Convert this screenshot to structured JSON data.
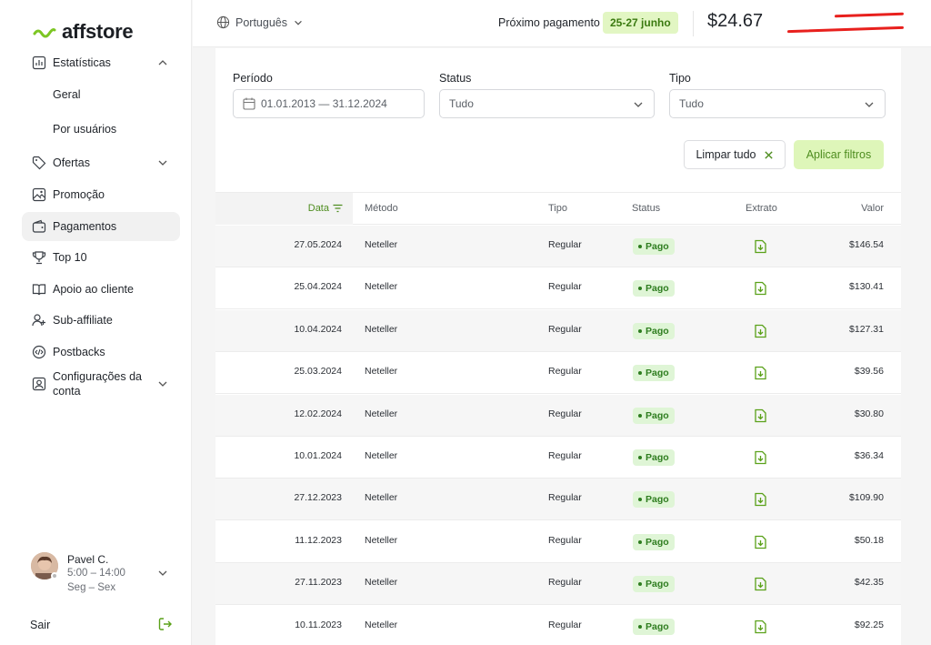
{
  "brand": {
    "name": "affstore",
    "accent": "#7cc623"
  },
  "sidebar": {
    "items": [
      {
        "label": "Estatísticas",
        "icon": "bar-chart-icon"
      },
      {
        "label": "Ofertas",
        "icon": "tag-icon"
      },
      {
        "label": "Promoção",
        "icon": "image-icon"
      },
      {
        "label": "Pagamentos",
        "icon": "wallet-icon"
      },
      {
        "label": "Top 10",
        "icon": "trophy-icon"
      },
      {
        "label": "Apoio ao cliente",
        "icon": "book-icon"
      },
      {
        "label": "Sub-affiliate",
        "icon": "user-plus-icon"
      },
      {
        "label": "Postbacks",
        "icon": "code-icon"
      },
      {
        "label": "Configurações da conta",
        "icon": "account-icon"
      }
    ],
    "sub_items": [
      "Geral",
      "Por usuários"
    ],
    "user": {
      "name": "Pavel C.",
      "hours": "5:00 – 14:00",
      "days": "Seg – Sex"
    },
    "logout_label": "Sair"
  },
  "topbar": {
    "language": "Português",
    "next_payment_label": "Próximo pagamento",
    "next_payment_dates": "25-27 junho",
    "balance": "$24.67"
  },
  "filters": {
    "period_label": "Período",
    "period_value": "01.01.2013 — 31.12.2024",
    "status_label": "Status",
    "status_value": "Tudo",
    "type_label": "Tipo",
    "type_value": "Tudo",
    "clear_label": "Limpar tudo",
    "apply_label": "Aplicar filtros"
  },
  "table": {
    "columns": [
      "Data",
      "Método",
      "Tipo",
      "Status",
      "Extrato",
      "Valor"
    ],
    "rows": [
      {
        "date": "27.05.2024",
        "method": "Neteller",
        "type": "Regular",
        "status": "Pago",
        "value": "$146.54"
      },
      {
        "date": "25.04.2024",
        "method": "Neteller",
        "type": "Regular",
        "status": "Pago",
        "value": "$130.41"
      },
      {
        "date": "10.04.2024",
        "method": "Neteller",
        "type": "Regular",
        "status": "Pago",
        "value": "$127.31"
      },
      {
        "date": "25.03.2024",
        "method": "Neteller",
        "type": "Regular",
        "status": "Pago",
        "value": "$39.56"
      },
      {
        "date": "12.02.2024",
        "method": "Neteller",
        "type": "Regular",
        "status": "Pago",
        "value": "$30.80"
      },
      {
        "date": "10.01.2024",
        "method": "Neteller",
        "type": "Regular",
        "status": "Pago",
        "value": "$36.34"
      },
      {
        "date": "27.12.2023",
        "method": "Neteller",
        "type": "Regular",
        "status": "Pago",
        "value": "$109.90"
      },
      {
        "date": "11.12.2023",
        "method": "Neteller",
        "type": "Regular",
        "status": "Pago",
        "value": "$50.18"
      },
      {
        "date": "27.11.2023",
        "method": "Neteller",
        "type": "Regular",
        "status": "Pago",
        "value": "$42.35"
      },
      {
        "date": "10.11.2023",
        "method": "Neteller",
        "type": "Regular",
        "status": "Pago",
        "value": "$92.25"
      }
    ]
  }
}
